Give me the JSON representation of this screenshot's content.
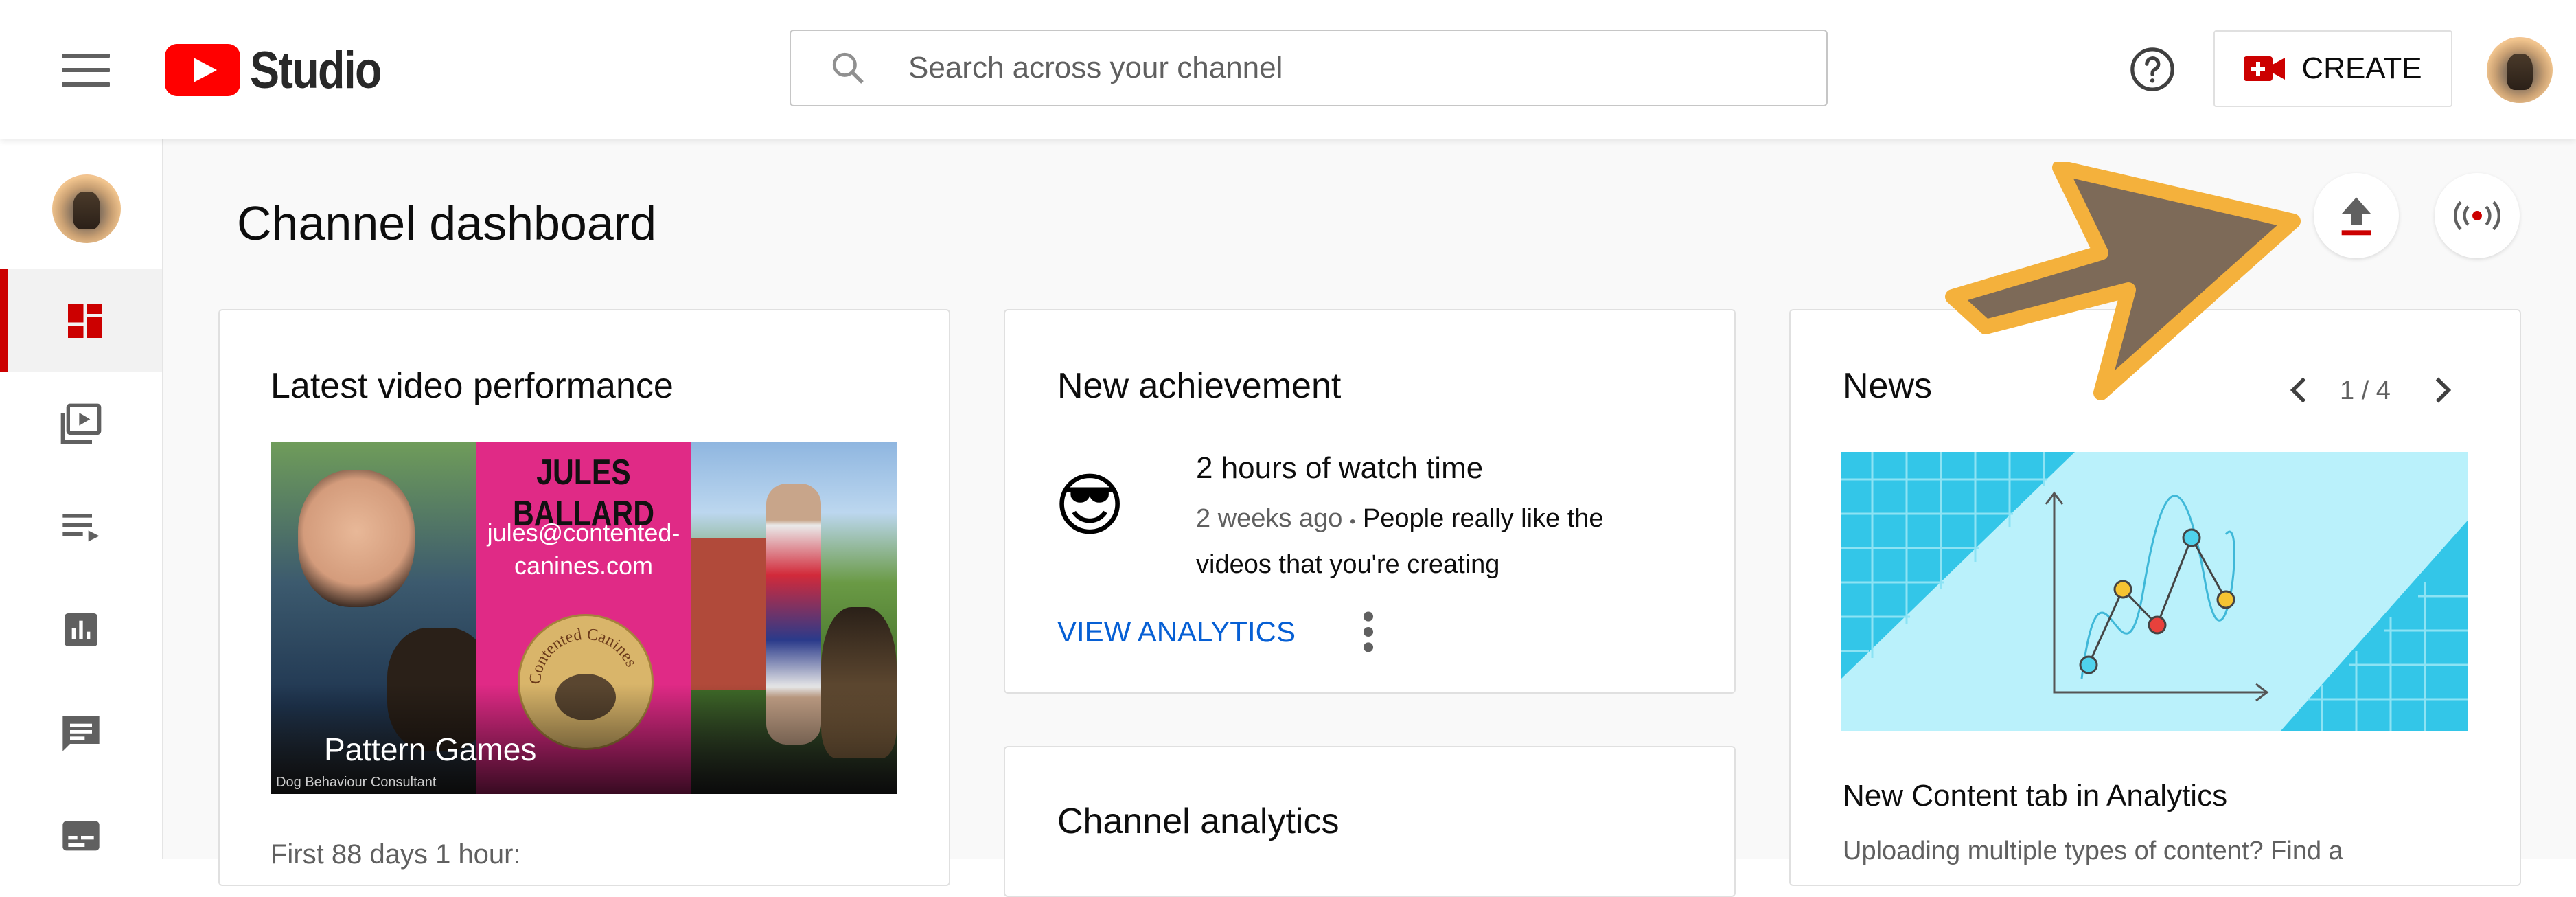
{
  "header": {
    "app_name": "Studio",
    "search_placeholder": "Search across your channel",
    "create_label": "CREATE"
  },
  "icons": {
    "menu": "hamburger-icon",
    "logo": "youtube-play-icon",
    "search": "search-icon",
    "help": "help-icon",
    "create": "video-camera-icon",
    "upload": "upload-icon",
    "live": "live-broadcast-icon",
    "sidebar": [
      "dashboard-icon",
      "content-icon",
      "playlists-icon",
      "analytics-icon",
      "comments-icon",
      "subtitles-icon"
    ]
  },
  "page": {
    "title": "Channel dashboard"
  },
  "latest_video": {
    "title": "Latest video performance",
    "thumbnail_name": "JULES BALLARD",
    "thumbnail_email": "jules@contented-canines.com",
    "thumbnail_seal": "Contented Canines",
    "thumbnail_footer": "Dog Behaviour Consultant",
    "video_title": "Pattern Games",
    "summary": "First 88 days 1 hour:"
  },
  "achievement": {
    "title": "New achievement",
    "emoji": "😎",
    "headline": "2 hours of watch time",
    "time": "2 weeks ago",
    "separator": "•",
    "message": "People really like the videos that you're creating",
    "action": "VIEW ANALYTICS"
  },
  "channel_analytics": {
    "title": "Channel analytics"
  },
  "news": {
    "title": "News",
    "pager": "1 / 4",
    "headline": "New Content tab in Analytics",
    "body": "Uploading multiple types of content? Find a"
  },
  "colors": {
    "brand_red": "#ff0000",
    "accent_red": "#cc0000",
    "link_blue": "#065fd4",
    "annotation_arrow": "#7d6a58",
    "annotation_outline": "#f4b13c"
  }
}
